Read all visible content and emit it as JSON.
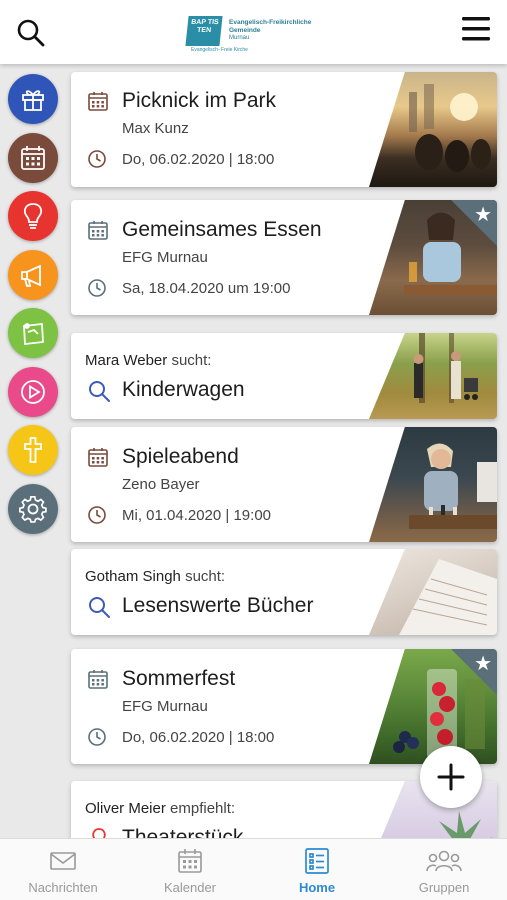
{
  "header": {
    "logo": {
      "mark_text": "BAP TIS TEN",
      "sub_text": "Evangelisch- Freie Kirche",
      "org_name": "Evangelisch-Freikirchliche Gemeinde",
      "place": "Murnau"
    }
  },
  "rail": [
    {
      "icon": "gift-icon",
      "color": "#2f55b8"
    },
    {
      "icon": "calendar-icon",
      "color": "#7a4a3a"
    },
    {
      "icon": "lightbulb-icon",
      "color": "#e8342f"
    },
    {
      "icon": "megaphone-icon",
      "color": "#f7941d"
    },
    {
      "icon": "pinboard-icon",
      "color": "#7dc242"
    },
    {
      "icon": "play-icon",
      "color": "#e84a8a"
    },
    {
      "icon": "cross-icon",
      "color": "#f5c518"
    },
    {
      "icon": "gear-icon",
      "color": "#5b6f7a"
    }
  ],
  "feed": {
    "events": [
      {
        "title": "Picknick im Park",
        "organizer": "Max Kunz",
        "date": "Do, 06.02.2020 | 18:00",
        "favorite": false
      },
      {
        "title": "Gemeinsames Essen",
        "organizer": "EFG Murnau",
        "date": "Sa, 18.04.2020 um 19:00",
        "favorite": true
      },
      {
        "title": "Spieleabend",
        "organizer": "Zeno Bayer",
        "date": "Mi, 01.04.2020 | 19:00",
        "favorite": false
      },
      {
        "title": "Sommerfest",
        "organizer": "EFG Murnau",
        "date": "Do, 06.02.2020 | 18:00",
        "favorite": true
      }
    ],
    "searches": [
      {
        "user": "Mara Weber",
        "verb": "sucht:",
        "item": "Kinderwagen"
      },
      {
        "user": "Gotham Singh",
        "verb": "sucht:",
        "item": "Lesenswerte Bücher"
      }
    ],
    "recommendation": {
      "user": "Oliver Meier",
      "verb": "empfiehlt:",
      "item": "Theaterstück"
    }
  },
  "tabs": [
    {
      "label": "Nachrichten",
      "icon": "envelope-icon",
      "active": false
    },
    {
      "label": "Kalender",
      "icon": "calendar-icon",
      "active": false
    },
    {
      "label": "Home",
      "icon": "list-icon",
      "active": true
    },
    {
      "label": "Gruppen",
      "icon": "group-icon",
      "active": false
    }
  ],
  "colors": {
    "accent": "#2b8ad2",
    "brown": "#7a4a3a",
    "slate": "#5b6f7a"
  }
}
